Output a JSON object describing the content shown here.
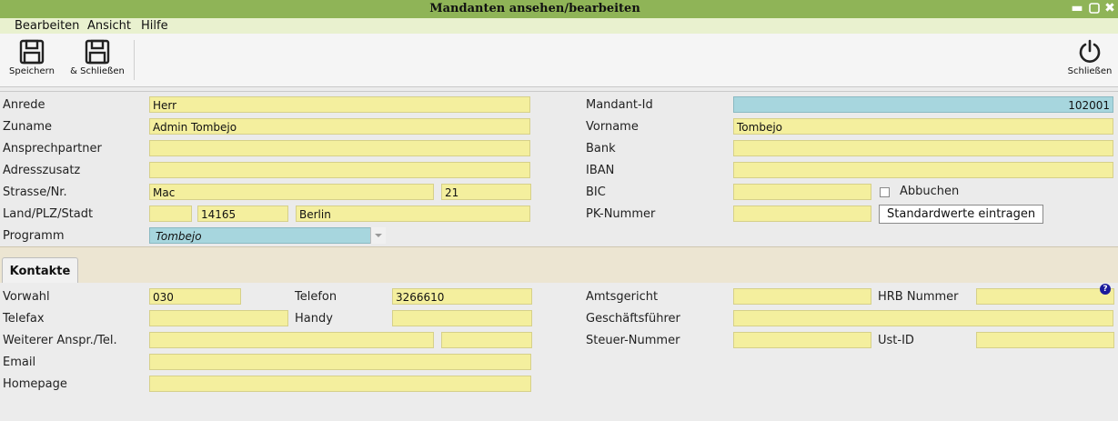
{
  "window": {
    "title": "Mandanten ansehen/bearbeiten"
  },
  "menu": {
    "items": [
      "Bearbeiten",
      "Ansicht",
      "Hilfe"
    ]
  },
  "toolbar": {
    "save": "Speichern",
    "save_close": "& Schließen",
    "close": "Schließen"
  },
  "form": {
    "anrede": {
      "label": "Anrede",
      "value": "Herr"
    },
    "zuname": {
      "label": "Zuname",
      "value": "Admin Tombejo"
    },
    "ansprechpartner": {
      "label": "Ansprechpartner",
      "value": ""
    },
    "adresszusatz": {
      "label": "Adresszusatz",
      "value": ""
    },
    "strasse": {
      "label": "Strasse/Nr.",
      "street": "Mac",
      "number": "21"
    },
    "land": {
      "label": "Land/PLZ/Stadt",
      "country": "",
      "plz": "14165",
      "city": "Berlin"
    },
    "programm": {
      "label": "Programm",
      "value": "Tombejo"
    },
    "mandant_id": {
      "label": "Mandant-Id",
      "value": "102001"
    },
    "vorname": {
      "label": "Vorname",
      "value": "Tombejo"
    },
    "bank": {
      "label": "Bank",
      "value": ""
    },
    "iban": {
      "label": "IBAN",
      "value": ""
    },
    "bic": {
      "label": "BIC",
      "value": ""
    },
    "abbuchen": {
      "label": "Abbuchen",
      "checked": false
    },
    "pk_nummer": {
      "label": "PK-Nummer",
      "value": ""
    },
    "standard_button": "Standardwerte eintragen"
  },
  "tabs": {
    "kontakte": "Kontakte"
  },
  "kontakte": {
    "vorwahl": {
      "label": "Vorwahl",
      "value": "030"
    },
    "telefon": {
      "label": "Telefon",
      "value": "3266610"
    },
    "telefax": {
      "label": "Telefax",
      "value": ""
    },
    "handy": {
      "label": "Handy",
      "value": ""
    },
    "weiterer": {
      "label": "Weiterer Anspr./Tel.",
      "name": "",
      "phone": ""
    },
    "email": {
      "label": "Email",
      "value": ""
    },
    "homepage": {
      "label": "Homepage",
      "value": ""
    },
    "amtsgericht": {
      "label": "Amtsgericht",
      "value": ""
    },
    "hrb": {
      "label": "HRB Nummer",
      "value": ""
    },
    "geschaeftsfuehrer": {
      "label": "Geschäftsführer",
      "value": ""
    },
    "steuer": {
      "label": "Steuer-Nummer",
      "value": ""
    },
    "ust": {
      "label": "Ust-ID",
      "value": ""
    }
  },
  "colors": {
    "titlebar": "#8fb457",
    "field": "#f4ef9e",
    "field_blue": "#a7d6de"
  },
  "icons": {
    "save": "floppy-disk-icon",
    "close": "power-icon",
    "help": "question-icon"
  }
}
